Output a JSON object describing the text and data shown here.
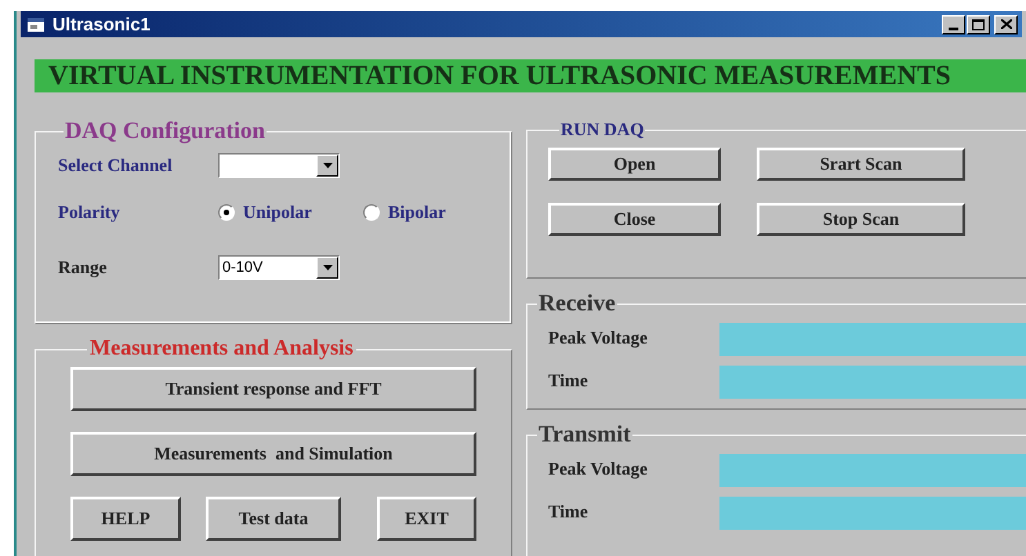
{
  "window": {
    "title": "Ultrasonic1"
  },
  "banner": "VIRTUAL INSTRUMENTATION FOR ULTRASONIC MEASUREMENTS",
  "daq_configuration": {
    "title": "DAQ Configuration",
    "select_channel": {
      "label": "Select Channel"
    },
    "polarity": {
      "label": "Polarity",
      "options": [
        {
          "label": "Unipolar",
          "selected": true
        },
        {
          "label": "Bipolar",
          "selected": false
        }
      ]
    },
    "range": {
      "label": "Range",
      "value": "0-10V"
    }
  },
  "measurements_and_analysis": {
    "title": "Measurements and Analysis",
    "wide_buttons": [
      "Transient response and FFT",
      "Measurements  and Simulation"
    ],
    "small_buttons": [
      "HELP",
      "Test data",
      "EXIT"
    ]
  },
  "run_daq": {
    "title": "RUN DAQ",
    "buttons": [
      [
        "Open",
        "Srart Scan"
      ],
      [
        "Close",
        "Stop Scan"
      ]
    ]
  },
  "receive": {
    "title": "Receive",
    "fields": [
      {
        "label": "Peak Voltage"
      },
      {
        "label": "Time"
      }
    ]
  },
  "transmit": {
    "title": "Transmit",
    "fields": [
      {
        "label": "Peak Voltage"
      },
      {
        "label": "Time"
      }
    ]
  }
}
